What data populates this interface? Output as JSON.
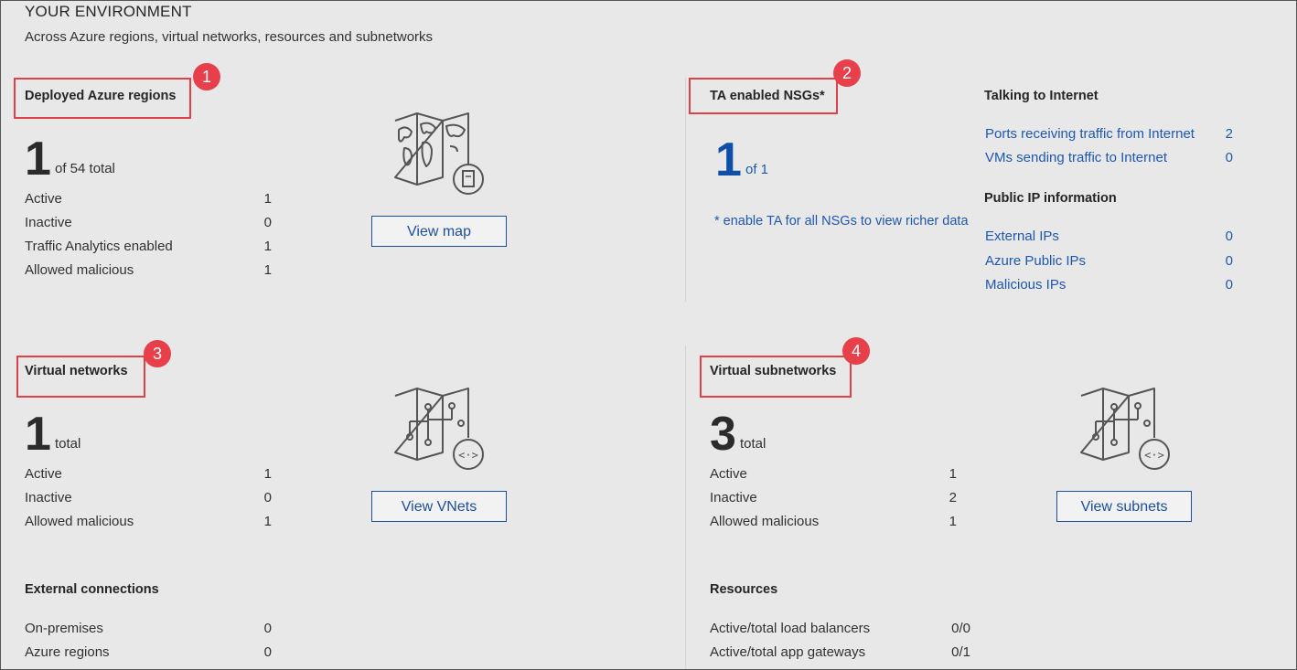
{
  "header": {
    "title": "YOUR ENVIRONMENT",
    "subtitle": "Across Azure regions, virtual networks, resources and subnetworks"
  },
  "regions": {
    "heading": "Deployed Azure regions",
    "badge": "1",
    "big_number": "1",
    "big_suffix": "of 54 total",
    "rows": [
      {
        "label": "Active",
        "value": "1"
      },
      {
        "label": "Inactive",
        "value": "0"
      },
      {
        "label": "Traffic Analytics enabled",
        "value": "1"
      },
      {
        "label": "Allowed malicious",
        "value": "1"
      }
    ],
    "button": "View map",
    "icon": "world-map-icon"
  },
  "nsgs": {
    "heading": "TA enabled NSGs*",
    "badge": "2",
    "big_number": "1",
    "big_suffix": "of 1",
    "note": "* enable TA for all NSGs to view richer data",
    "talking_heading": "Talking to Internet",
    "talking_rows": [
      {
        "label": "Ports receiving traffic from Internet",
        "value": "2"
      },
      {
        "label": "VMs sending traffic to Internet",
        "value": "0"
      }
    ],
    "public_ip_heading": "Public IP information",
    "public_ip_rows": [
      {
        "label": "External IPs",
        "value": "0"
      },
      {
        "label": "Azure Public IPs",
        "value": "0"
      },
      {
        "label": "Malicious IPs",
        "value": "0"
      }
    ]
  },
  "vnets": {
    "heading": "Virtual networks",
    "badge": "3",
    "big_number": "1",
    "big_suffix": "total",
    "rows": [
      {
        "label": "Active",
        "value": "1"
      },
      {
        "label": "Inactive",
        "value": "0"
      },
      {
        "label": "Allowed malicious",
        "value": "1"
      }
    ],
    "button": "View VNets",
    "icon": "vnet-map-icon"
  },
  "subnets": {
    "heading": "Virtual subnetworks",
    "badge": "4",
    "big_number": "3",
    "big_suffix": "total",
    "rows": [
      {
        "label": "Active",
        "value": "1"
      },
      {
        "label": "Inactive",
        "value": "2"
      },
      {
        "label": "Allowed malicious",
        "value": "1"
      }
    ],
    "button": "View subnets",
    "icon": "subnet-map-icon"
  },
  "external": {
    "heading": "External connections",
    "rows": [
      {
        "label": "On-premises",
        "value": "0"
      },
      {
        "label": "Azure regions",
        "value": "0"
      }
    ]
  },
  "resources": {
    "heading": "Resources",
    "rows": [
      {
        "label": "Active/total load balancers",
        "value": "0/0"
      },
      {
        "label": "Active/total app gateways",
        "value": "0/1"
      }
    ]
  }
}
